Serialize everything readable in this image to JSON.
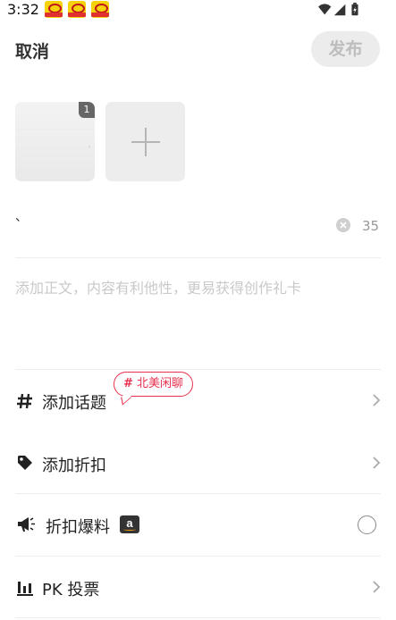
{
  "status_bar": {
    "time": "3:32"
  },
  "header": {
    "cancel_label": "取消",
    "publish_label": "发布"
  },
  "images": {
    "thumbnail_badge": "1"
  },
  "title": {
    "value": "、",
    "char_count": "35"
  },
  "body": {
    "placeholder": "添加正文，内容有利他性，更易获得创作礼卡"
  },
  "options": {
    "topic": {
      "label": "添加话题",
      "tag": "北美闲聊"
    },
    "discount": {
      "label": "添加折扣"
    },
    "deal": {
      "label": "折扣爆料",
      "badge": "a"
    },
    "poll": {
      "label": "PK 投票"
    }
  },
  "colors": {
    "accent": "#e8314f",
    "publish_bg": "#ececec",
    "publish_text": "#bdbdbd"
  }
}
